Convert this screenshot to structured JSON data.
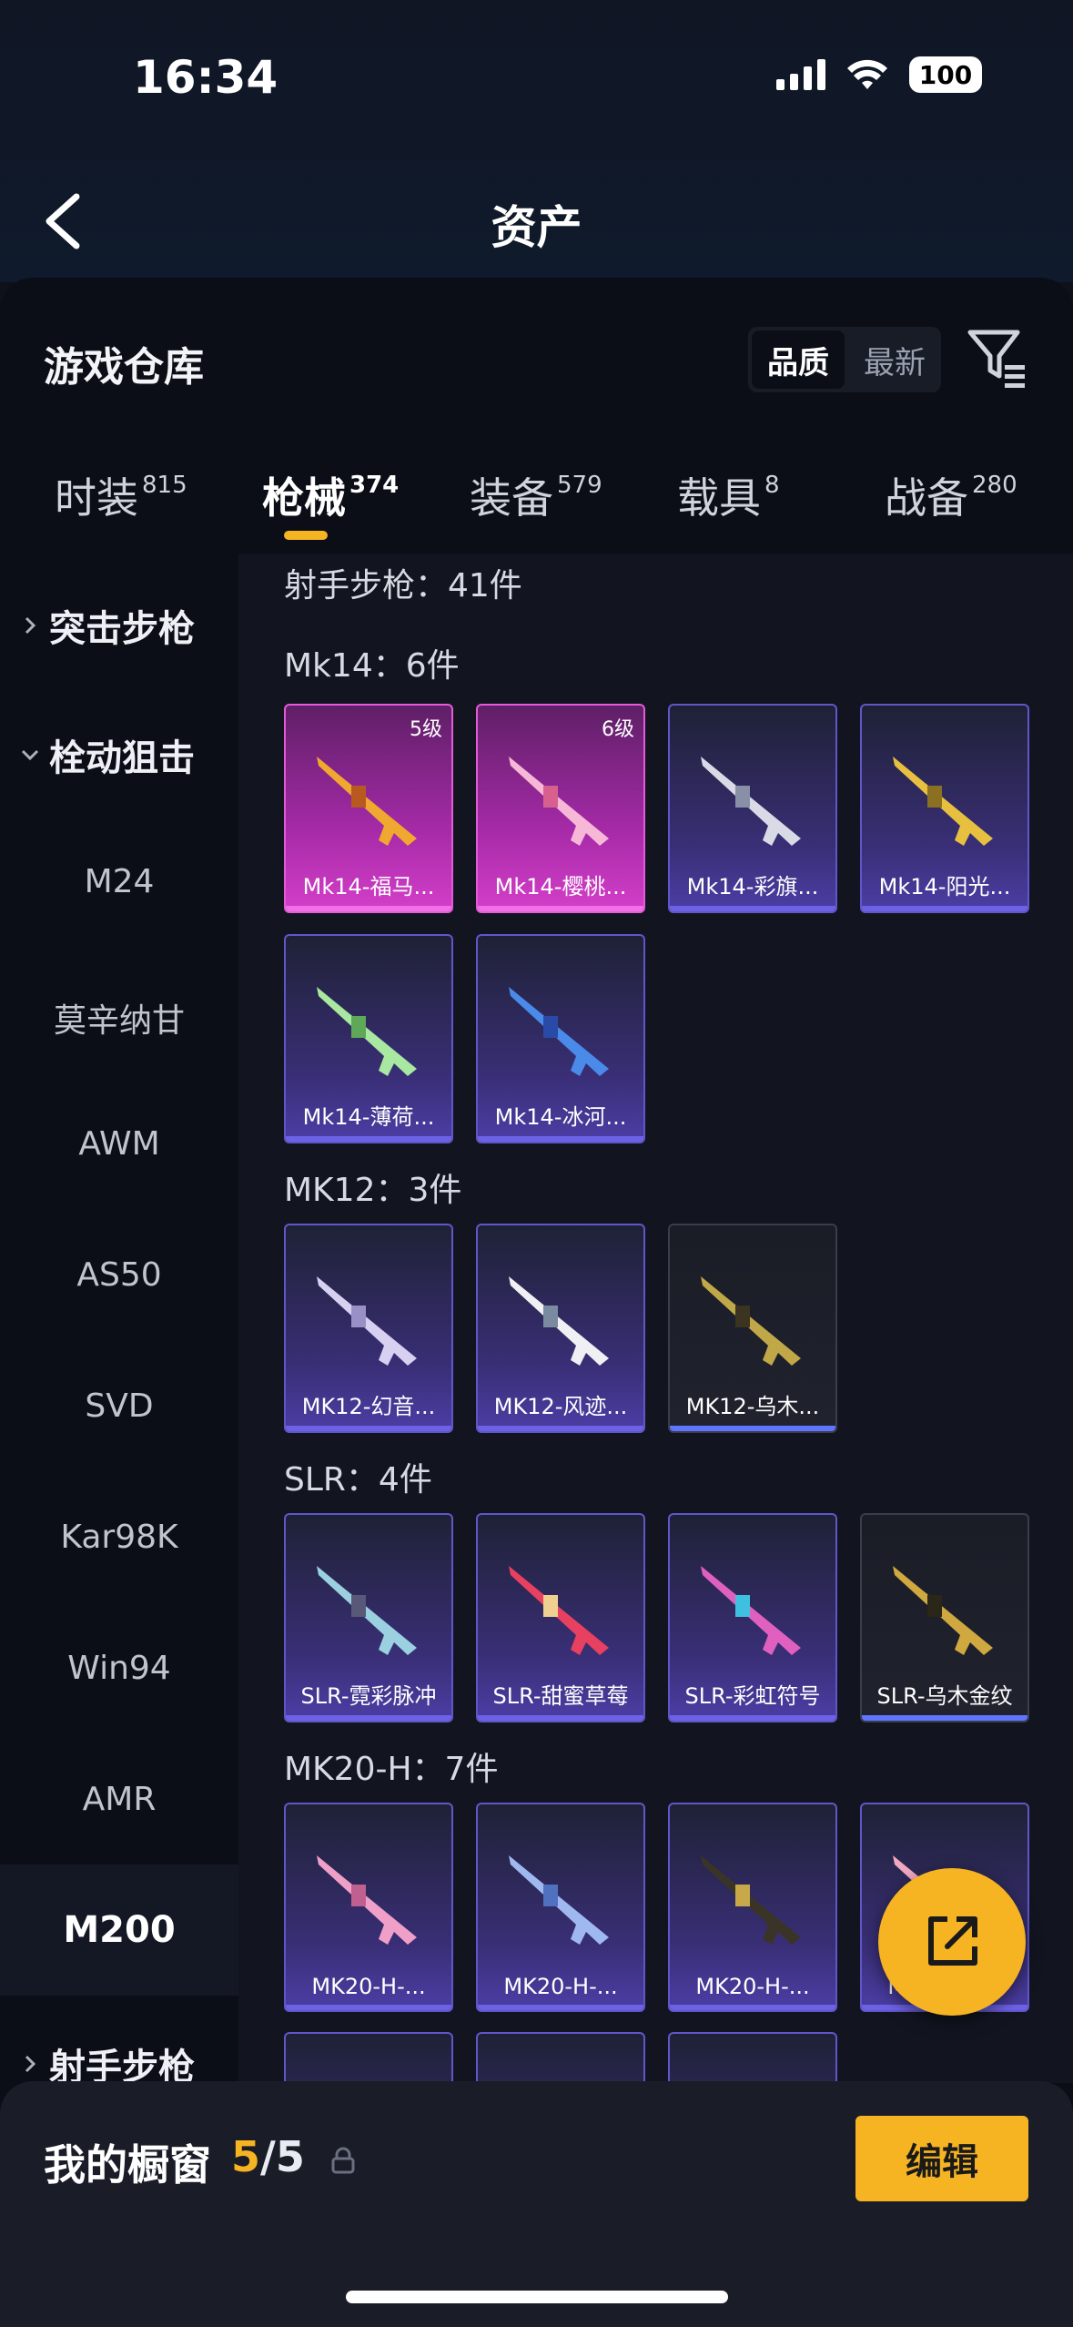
{
  "status_bar": {
    "time": "16:34",
    "battery": "100"
  },
  "header": {
    "title": "资产"
  },
  "warehouse": {
    "title": "游戏仓库",
    "sort": {
      "quality": "品质",
      "latest": "最新"
    }
  },
  "tabs": [
    {
      "label": "时装",
      "count": "815"
    },
    {
      "label": "枪械",
      "count": "374"
    },
    {
      "label": "装备",
      "count": "579"
    },
    {
      "label": "载具",
      "count": "8"
    },
    {
      "label": "战备",
      "count": "280"
    }
  ],
  "sidebar": {
    "group1": "突击步枪",
    "group2": "栓动狙击",
    "items": [
      "M24",
      "莫辛纳甘",
      "AWM",
      "AS50",
      "SVD",
      "Kar98K",
      "Win94",
      "AMR",
      "M200"
    ],
    "group3": "射手步枪"
  },
  "content": {
    "section_total": "射手步枪：41件",
    "groups": [
      {
        "title": "Mk14：6件",
        "items": [
          {
            "name": "Mk14-福马...",
            "level": "5级"
          },
          {
            "name": "Mk14-樱桃...",
            "level": "6级"
          },
          {
            "name": "Mk14-彩旗..."
          },
          {
            "name": "Mk14-阳光..."
          },
          {
            "name": "Mk14-薄荷..."
          },
          {
            "name": "Mk14-冰河..."
          }
        ]
      },
      {
        "title": "MK12：3件",
        "items": [
          {
            "name": "MK12-幻音..."
          },
          {
            "name": "MK12-风迹..."
          },
          {
            "name": "MK12-乌木..."
          }
        ]
      },
      {
        "title": "SLR：4件",
        "items": [
          {
            "name": "SLR-霓彩脉冲"
          },
          {
            "name": "SLR-甜蜜草莓"
          },
          {
            "name": "SLR-彩虹符号"
          },
          {
            "name": "SLR-乌木金纹"
          }
        ]
      },
      {
        "title": "MK20-H：7件",
        "items": [
          {
            "name": "MK20-H-..."
          },
          {
            "name": "MK20-H-..."
          },
          {
            "name": "MK20-H-..."
          },
          {
            "name": "MK20-H-..."
          }
        ]
      }
    ]
  },
  "showcase": {
    "label": "我的橱窗",
    "current": "5",
    "total": "/5",
    "edit": "编辑"
  },
  "colors": {
    "accent": "#f6b322",
    "epic": "#6d62e6",
    "legendary": "#e45ad8"
  }
}
